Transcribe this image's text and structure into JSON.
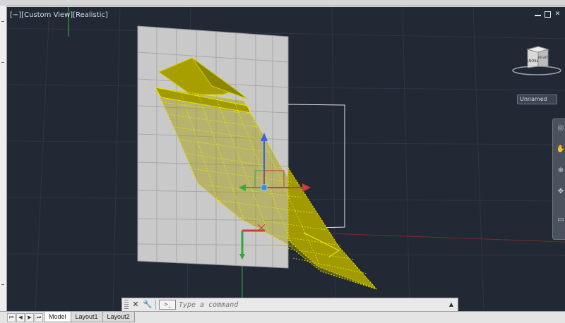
{
  "viewport": {
    "label": "[−][Custom View][Realistic]",
    "window_controls": [
      "minimize",
      "restore",
      "close"
    ],
    "background": "#222934"
  },
  "viewcube": {
    "faces": [
      "FRONT",
      "RIGHT"
    ],
    "icon": "viewcube-icon"
  },
  "ucs_dropdown": {
    "value": "Unnamed"
  },
  "navigation_bar": {
    "tools": [
      "steering-wheel-icon",
      "pan-icon",
      "zoom-icon",
      "orbit-icon",
      "showmotion-icon"
    ]
  },
  "command_line": {
    "close_label": "✕",
    "settings_label": "🔧",
    "prompt_icon": ">_",
    "placeholder": "Type a command",
    "arrow_label": "▲"
  },
  "layout_tabs": {
    "nav_buttons": [
      "⏮",
      "◀",
      "▶",
      "⏭"
    ],
    "tabs": [
      "Model",
      "Layout1",
      "Layout2"
    ],
    "active": "Model"
  },
  "colors": {
    "wall": "#c8c8c8",
    "surface_fill": "#a19a00",
    "surface_highlight": "#e6e600",
    "gizmo_x": "#d23a3a",
    "gizmo_y": "#3fa63f",
    "gizmo_z": "#3c63d6"
  }
}
